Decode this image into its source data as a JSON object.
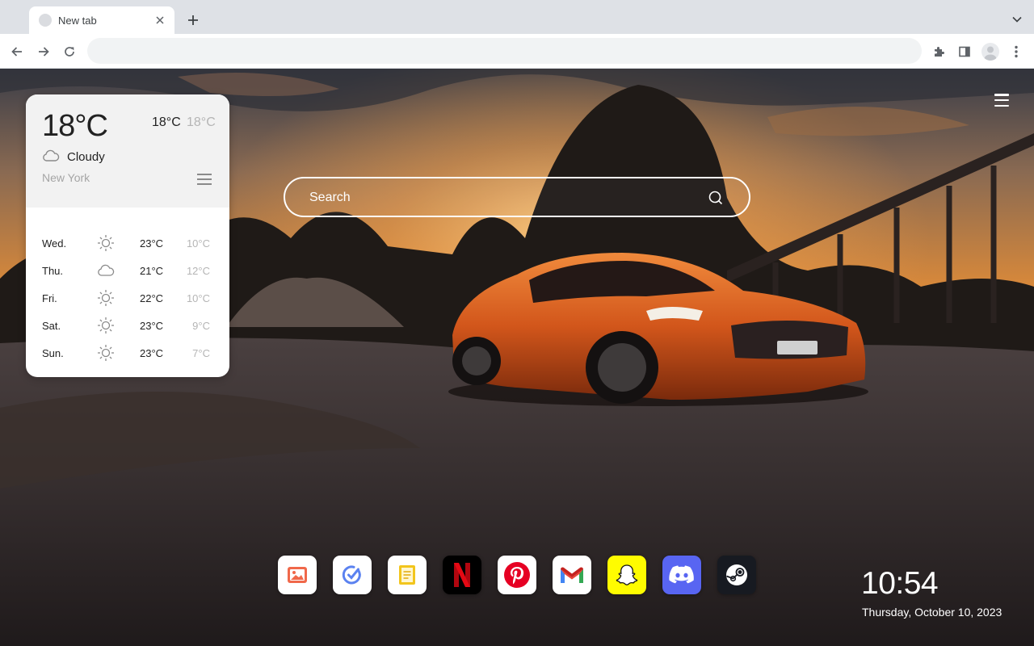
{
  "browser": {
    "tab": {
      "title": "New tab",
      "close_glyph": "✕"
    },
    "new_tab_glyph": "+",
    "omnibox": {
      "value": "",
      "placeholder": ""
    }
  },
  "weather": {
    "current_temp": "18°C",
    "high": "18°C",
    "low": "18°C",
    "condition": "Cloudy",
    "condition_icon": "cloud-icon",
    "city": "New York",
    "forecast": [
      {
        "day": "Wed.",
        "icon": "sun-icon",
        "high": "23°C",
        "low": "10°C"
      },
      {
        "day": "Thu.",
        "icon": "cloud-icon",
        "high": "21°C",
        "low": "12°C"
      },
      {
        "day": "Fri.",
        "icon": "sun-icon",
        "high": "22°C",
        "low": "10°C"
      },
      {
        "day": "Sat.",
        "icon": "sun-icon",
        "high": "23°C",
        "low": "9°C"
      },
      {
        "day": "Sun.",
        "icon": "sun-icon",
        "high": "23°C",
        "low": "7°C"
      }
    ]
  },
  "search": {
    "placeholder": "Search"
  },
  "dock": [
    {
      "icon": "gallery-icon",
      "bg": "#ffffff"
    },
    {
      "icon": "todo-icon",
      "bg": "#ffffff"
    },
    {
      "icon": "notes-icon",
      "bg": "#ffffff"
    },
    {
      "icon": "netflix-icon",
      "bg": "#000000"
    },
    {
      "icon": "pinterest-icon",
      "bg": "#ffffff"
    },
    {
      "icon": "gmail-icon",
      "bg": "#ffffff"
    },
    {
      "icon": "snapchat-icon",
      "bg": "#fffc00"
    },
    {
      "icon": "discord-icon",
      "bg": "#5865f2"
    },
    {
      "icon": "steam-icon",
      "bg": "#171a21"
    }
  ],
  "clock": {
    "time": "10:54",
    "date": "Thursday, October 10, 2023"
  },
  "colors": {
    "accent_netflix": "#e50914",
    "accent_pinterest": "#e60023",
    "accent_discord": "#5865f2",
    "accent_snapchat": "#fffc00"
  }
}
